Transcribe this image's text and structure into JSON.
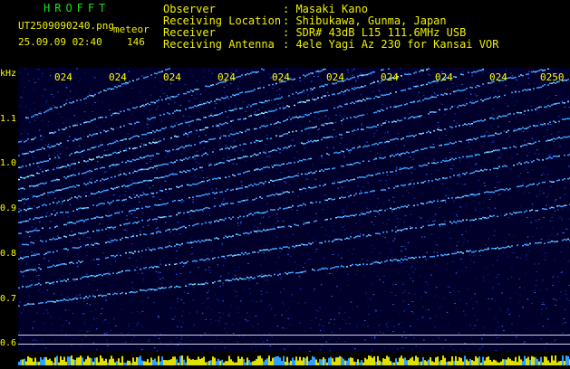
{
  "header": {
    "app_title": "HROFFT",
    "filename": "UT2509090240.png",
    "mode": "meteor",
    "datetime": "25.09.09 02:40",
    "count": "146",
    "observer_label": "Observer",
    "observer_value": ": Masaki Kano",
    "location_label": "Receiving Location",
    "location_value": ": Shibukawa, Gunma, Japan",
    "receiver_label": "Receiver",
    "receiver_value": ": SDR# 43dB L15 111.6MHz USB",
    "antenna_label": "Receiving Antenna",
    "antenna_value": ": 4ele Yagi Az 230 for Kansai VOR"
  },
  "axis": {
    "unit": "kHz",
    "y_ticks": [
      "1.1",
      "1.0",
      "0.9",
      "0.8",
      "0.7",
      "0.6"
    ],
    "x_ticks": [
      "024",
      "024",
      "024",
      "024",
      "024",
      "024",
      "024",
      "024",
      "024",
      "0250"
    ]
  },
  "colors": {
    "background": "#000000",
    "spectrogram_bg": "#00002a",
    "trace": "#3aa0ff",
    "trace_bright": "#9ff5ff",
    "text_yellow": "#f0f000",
    "text_green": "#19e019"
  }
}
